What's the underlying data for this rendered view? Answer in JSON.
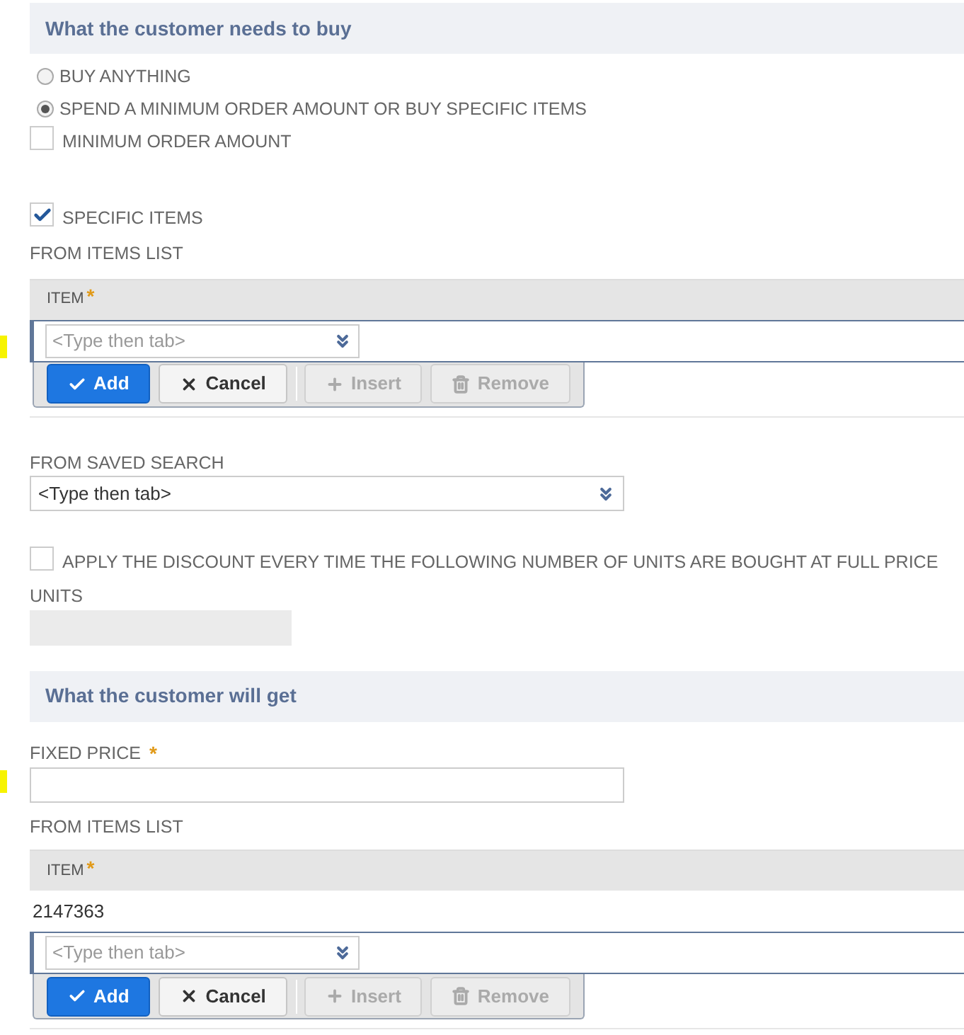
{
  "buy": {
    "title": "What the customer needs to buy",
    "radios": [
      {
        "label": "BUY ANYTHING",
        "selected": false
      },
      {
        "label": "SPEND A MINIMUM ORDER AMOUNT OR BUY SPECIFIC ITEMS",
        "selected": true
      }
    ],
    "minimum_order": {
      "label": "MINIMUM ORDER AMOUNT",
      "checked": false
    },
    "specific_items": {
      "label": "SPECIFIC ITEMS",
      "checked": true
    },
    "from_items_list": "FROM ITEMS LIST",
    "item_list": {
      "column": "ITEM",
      "required_mark": "*",
      "entry_placeholder": "<Type then tab>",
      "buttons": [
        {
          "label": "Add",
          "kind": "add",
          "primary": true,
          "disabled": false
        },
        {
          "label": "Cancel",
          "kind": "cancel",
          "primary": false,
          "disabled": false
        },
        {
          "label": "Insert",
          "kind": "insert",
          "primary": false,
          "disabled": true
        },
        {
          "label": "Remove",
          "kind": "remove",
          "primary": false,
          "disabled": true
        }
      ]
    },
    "saved_search": {
      "label": "FROM SAVED SEARCH",
      "value": "<Type then tab>"
    },
    "apply_every": {
      "label": "APPLY THE DISCOUNT EVERY TIME THE FOLLOWING NUMBER OF UNITS ARE BOUGHT AT FULL PRICE",
      "checked": false
    },
    "units": {
      "label": "UNITS",
      "disabled": true
    }
  },
  "get": {
    "title": "What the customer will get",
    "fixed_price": {
      "label": "FIXED PRICE",
      "required_mark": "*"
    },
    "from_items_list": "FROM ITEMS LIST",
    "item_list": {
      "column": "ITEM",
      "required_mark": "*",
      "rows": [
        "2147363"
      ],
      "entry_placeholder": "<Type then tab>",
      "buttons": [
        {
          "label": "Add",
          "kind": "add",
          "primary": true,
          "disabled": false
        },
        {
          "label": "Cancel",
          "kind": "cancel",
          "primary": false,
          "disabled": false
        },
        {
          "label": "Insert",
          "kind": "insert",
          "primary": false,
          "disabled": true
        },
        {
          "label": "Remove",
          "kind": "remove",
          "primary": false,
          "disabled": true
        }
      ]
    }
  }
}
